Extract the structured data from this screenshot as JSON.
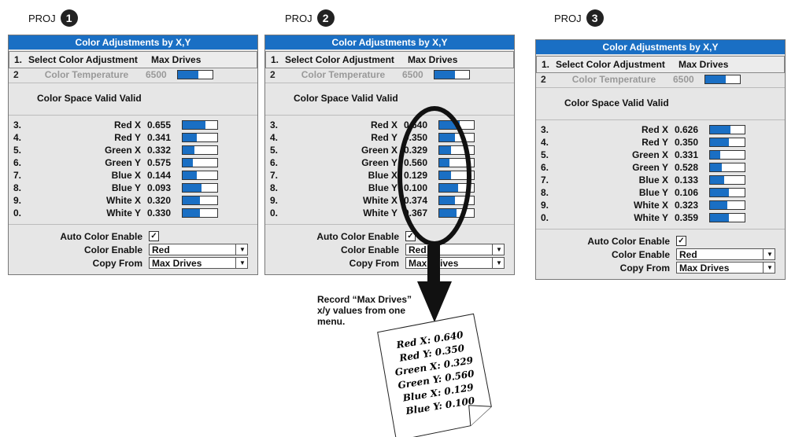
{
  "panels": [
    {
      "proj_label": "PROJ",
      "proj_num": "1",
      "title": "Color Adjustments by X,Y",
      "select": {
        "num": "1.",
        "label": "Select Color Adjustment",
        "value": "Max Drives"
      },
      "temp": {
        "num": "2",
        "label": "Color Temperature",
        "value": "6500",
        "level": 0.6
      },
      "valid_text": "Color Space Valid Valid",
      "rows": [
        {
          "num": "3.",
          "label": "Red X",
          "value": "0.655",
          "level": 0.65
        },
        {
          "num": "4.",
          "label": "Red Y",
          "value": "0.341",
          "level": 0.4
        },
        {
          "num": "5.",
          "label": "Green X",
          "value": "0.332",
          "level": 0.35
        },
        {
          "num": "6.",
          "label": "Green Y",
          "value": "0.575",
          "level": 0.3
        },
        {
          "num": "7.",
          "label": "Blue X",
          "value": "0.144",
          "level": 0.4
        },
        {
          "num": "8.",
          "label": "Blue Y",
          "value": "0.093",
          "level": 0.55
        },
        {
          "num": "9.",
          "label": "White X",
          "value": "0.320",
          "level": 0.5
        },
        {
          "num": "0.",
          "label": "White Y",
          "value": "0.330",
          "level": 0.5
        }
      ],
      "auto_label": "Auto Color Enable",
      "auto_check": "✓",
      "color_enable_label": "Color Enable",
      "color_enable_value": "Red",
      "copy_from_label": "Copy From",
      "copy_from_value": "Max Drives"
    },
    {
      "proj_label": "PROJ",
      "proj_num": "2",
      "title": "Color Adjustments by X,Y",
      "select": {
        "num": "1.",
        "label": "Select Color Adjustment",
        "value": "Max Drives"
      },
      "temp": {
        "num": "2",
        "label": "Color Temperature",
        "value": "6500",
        "level": 0.6
      },
      "valid_text": "Color Space Valid Valid",
      "rows": [
        {
          "num": "3.",
          "label": "Red X",
          "value": "0.640",
          "level": 0.6
        },
        {
          "num": "4.",
          "label": "Red Y",
          "value": "0.350",
          "level": 0.45
        },
        {
          "num": "5.",
          "label": "Green X",
          "value": "0.329",
          "level": 0.35
        },
        {
          "num": "6.",
          "label": "Green Y",
          "value": "0.560",
          "level": 0.3
        },
        {
          "num": "7.",
          "label": "Blue X",
          "value": "0.129",
          "level": 0.35
        },
        {
          "num": "8.",
          "label": "Blue Y",
          "value": "0.100",
          "level": 0.55
        },
        {
          "num": "9.",
          "label": "White X",
          "value": "0.374",
          "level": 0.45
        },
        {
          "num": "0.",
          "label": "White Y",
          "value": "0.367",
          "level": 0.5
        }
      ],
      "auto_label": "Auto Color Enable",
      "auto_check": "✓",
      "color_enable_label": "Color Enable",
      "color_enable_value": "Red",
      "copy_from_label": "Copy From",
      "copy_from_value": "Max Drives"
    },
    {
      "proj_label": "PROJ",
      "proj_num": "3",
      "title": "Color Adjustments by X,Y",
      "select": {
        "num": "1.",
        "label": "Select Color Adjustment",
        "value": "Max Drives"
      },
      "temp": {
        "num": "2",
        "label": "Color Temperature",
        "value": "6500",
        "level": 0.6
      },
      "valid_text": "Color Space Valid Valid",
      "rows": [
        {
          "num": "3.",
          "label": "Red X",
          "value": "0.626",
          "level": 0.6
        },
        {
          "num": "4.",
          "label": "Red Y",
          "value": "0.350",
          "level": 0.55
        },
        {
          "num": "5.",
          "label": "Green X",
          "value": "0.331",
          "level": 0.3
        },
        {
          "num": "6.",
          "label": "Green Y",
          "value": "0.528",
          "level": 0.35
        },
        {
          "num": "7.",
          "label": "Blue X",
          "value": "0.133",
          "level": 0.4
        },
        {
          "num": "8.",
          "label": "Blue Y",
          "value": "0.106",
          "level": 0.55
        },
        {
          "num": "9.",
          "label": "White X",
          "value": "0.323",
          "level": 0.5
        },
        {
          "num": "0.",
          "label": "White Y",
          "value": "0.359",
          "level": 0.55
        }
      ],
      "auto_label": "Auto Color Enable",
      "auto_check": "✓",
      "color_enable_label": "Color Enable",
      "color_enable_value": "Red",
      "copy_from_label": "Copy From",
      "copy_from_value": "Max Drives"
    }
  ],
  "note": "Record “Max Drives” x/y values from one menu.",
  "paper_lines": [
    "Red X: 0.640",
    "Red Y: 0.350",
    "Green X: 0.329",
    "Green Y: 0.560",
    "Blue X: 0.129",
    "Blue Y: 0.100"
  ],
  "accent": "#1a6fc4"
}
